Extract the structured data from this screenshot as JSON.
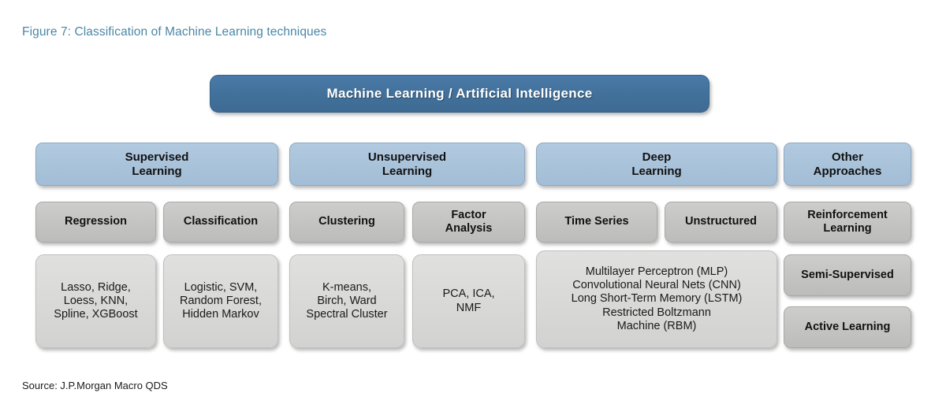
{
  "figure": {
    "title": "Figure 7: Classification of Machine Learning techniques",
    "source": "Source: J.P.Morgan Macro QDS",
    "title_color": "#4a87a8"
  },
  "colors": {
    "root_fill": "#41709a",
    "category_fill": "#a9c3da",
    "subcategory_fill": "#c4c4c3",
    "leaf_fill": "#d9d9d8",
    "root_text": "#ffffff",
    "body_text": "#111111",
    "page_background": "#ffffff"
  },
  "diagram": {
    "type": "hierarchy-tree",
    "root": {
      "label": "Machine Learning / Artificial  Intelligence"
    },
    "categories": [
      {
        "label": "Supervised\nLearning",
        "line1": "Supervised",
        "line2": "Learning"
      },
      {
        "label": "Unsupervised\nLearning",
        "line1": "Unsupervised",
        "line2": "Learning"
      },
      {
        "label": "Deep\nLearning",
        "line1": "Deep",
        "line2": "Learning"
      },
      {
        "label": "Other\nApproaches",
        "line1": "Other",
        "line2": "Approaches"
      }
    ],
    "subcategories": [
      {
        "line1": "Regression",
        "line2": ""
      },
      {
        "line1": "Classification",
        "line2": ""
      },
      {
        "line1": "Clustering",
        "line2": ""
      },
      {
        "line1": "Factor",
        "line2": "Analysis"
      },
      {
        "line1": "Time Series",
        "line2": ""
      },
      {
        "line1": "Unstructured",
        "line2": ""
      },
      {
        "line1": "Reinforcement",
        "line2": "Learning"
      }
    ],
    "other_approaches_extra": [
      {
        "line1": "Semi-Supervised"
      },
      {
        "line1": "Active Learning"
      }
    ],
    "leaves": [
      {
        "parent": "Regression",
        "lines": [
          "Lasso, Ridge,",
          "Loess, KNN,",
          "Spline, XGBoost"
        ]
      },
      {
        "parent": "Classification",
        "lines": [
          "Logistic, SVM,",
          "Random Forest,",
          "Hidden Markov"
        ]
      },
      {
        "parent": "Clustering",
        "lines": [
          "K-means,",
          "Birch, Ward",
          "Spectral Cluster"
        ]
      },
      {
        "parent": "Factor Analysis",
        "lines": [
          "PCA, ICA,",
          "NMF"
        ]
      },
      {
        "parent": "Deep Learning",
        "lines": [
          "Multilayer  Perceptron (MLP)",
          "Convolutional  Neural Nets (CNN)",
          "Long Short-Term  Memory  (LSTM)",
          "Restricted Boltzmann",
          "Machine (RBM)"
        ]
      }
    ]
  }
}
